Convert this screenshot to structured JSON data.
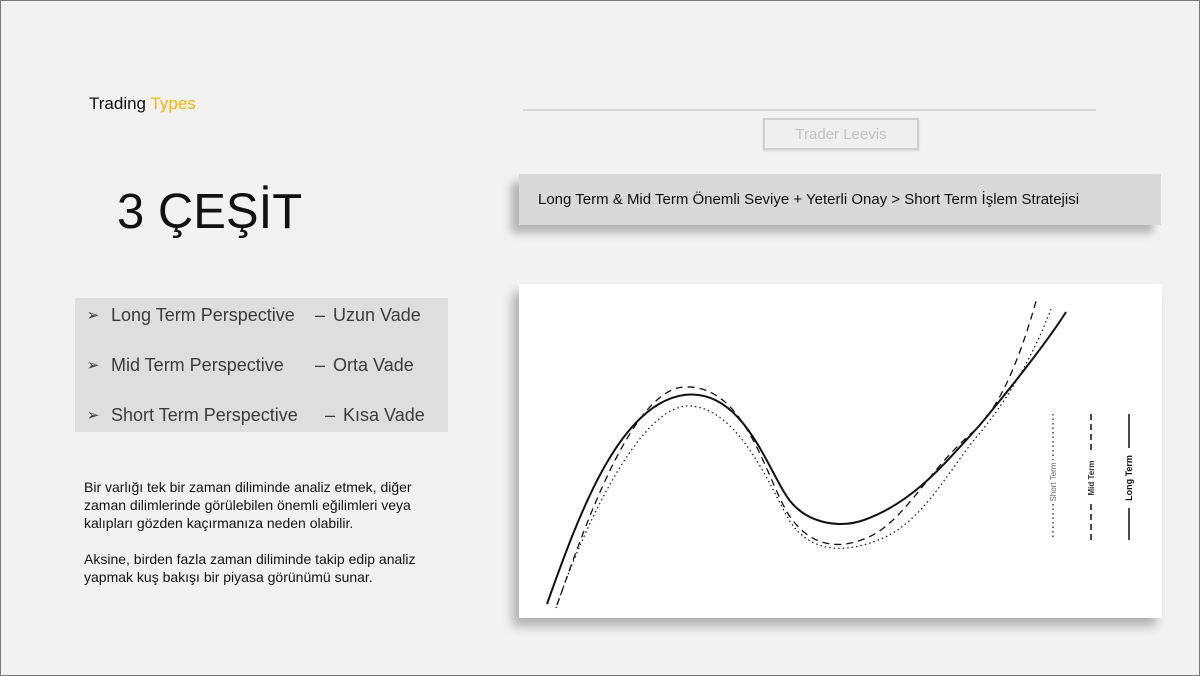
{
  "slide": {
    "title_prefix": "Trading",
    "title_accent": "Types",
    "brand": "Trader Leevis",
    "heading": "3 ÇEŞİT",
    "banner": "Long Term & Mid Term Önemli Seviye + Yeterli Onay > Short Term İşlem Stratejisi",
    "accent_color": "#f2b705"
  },
  "perspectives": [
    {
      "term": "Long Term Perspective",
      "dash": "–",
      "turkish": "Uzun Vade"
    },
    {
      "term": "Mid Term Perspective",
      "dash": "–",
      "turkish": "Orta Vade"
    },
    {
      "term": "Short Term Perspective",
      "dash": "–",
      "turkish": "Kısa Vade"
    }
  ],
  "description": {
    "paragraph_1": "Bir varlığı tek bir zaman diliminde analiz etmek, diğer zaman dilimlerinde görülebilen önemli eğilimleri veya kalıpları gözden kaçırmanıza neden olabilir.",
    "paragraph_2": "Aksine, birden fazla zaman diliminde takip edip analiz yapmak kuş bakışı bir piyasa görünümü sunar."
  },
  "chart": {
    "legend": {
      "short": "Short Term",
      "mid": "Mid Term",
      "long": "Long Term"
    }
  }
}
